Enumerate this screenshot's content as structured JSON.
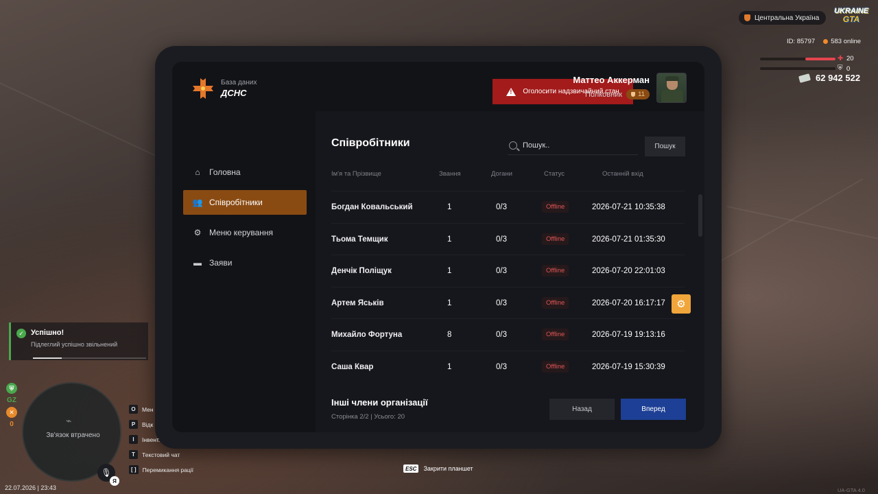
{
  "hud": {
    "region": "Центральна Україна",
    "logo_line1": "UKRAINE",
    "logo_line2": "GTA",
    "player_id": "ID: 85797",
    "online": "583 online",
    "health": "20",
    "armor": "0",
    "health_level": 0.4,
    "money": "62 942 522"
  },
  "tablet": {
    "brand_subtitle": "База даних",
    "brand_title": "ДСНС",
    "alert_button": "Оголосити надзвичайний стан",
    "user_name": "Маттео Аккерман",
    "user_rank": "Полковник",
    "rank_level": "11",
    "nav": [
      {
        "label": "Головна",
        "icon": "home-icon"
      },
      {
        "label": "Співробітники",
        "icon": "users-icon",
        "active": true
      },
      {
        "label": "Меню керування",
        "icon": "gear-icon"
      },
      {
        "label": "Заяви",
        "icon": "folder-icon"
      }
    ],
    "page_title": "Співробітники",
    "search_placeholder": "Пошук..",
    "search_button": "Пошук",
    "columns": [
      "Ім'я та Прізвище",
      "Звання",
      "Догани",
      "Статус",
      "Останній вхід"
    ],
    "employees": [
      {
        "name": "Богдан Ковальський",
        "rank": "1",
        "reprimands": "0/3",
        "status": "Offline",
        "last": "2026-07-21 10:35:38"
      },
      {
        "name": "Тьома Темщик",
        "rank": "1",
        "reprimands": "0/3",
        "status": "Offline",
        "last": "2026-07-21 01:35:30"
      },
      {
        "name": "Денчік Поліщук",
        "rank": "1",
        "reprimands": "0/3",
        "status": "Offline",
        "last": "2026-07-20 22:01:03"
      },
      {
        "name": "Артем Яськів",
        "rank": "1",
        "reprimands": "0/3",
        "status": "Offline",
        "last": "2026-07-20 16:17:17"
      },
      {
        "name": "Михайло Фортуна",
        "rank": "8",
        "reprimands": "0/3",
        "status": "Offline",
        "last": "2026-07-19 19:13:16"
      },
      {
        "name": "Саша Квар",
        "rank": "1",
        "reprimands": "0/3",
        "status": "Offline",
        "last": "2026-07-19 15:30:39"
      }
    ],
    "other_title": "Інші члени організації",
    "page_info": "Сторінка 2/2 | Усього: 20",
    "back_button": "Назад",
    "next_button": "Вперед"
  },
  "toast": {
    "title": "Успішно!",
    "message": "Підлеглий успішно звільнений"
  },
  "left_hud": {
    "gz_label": "GZ",
    "gz_count": "0",
    "minimap_message": "Зв'язок втрачено",
    "mic_key": "Я",
    "datetime": "22.07.2026 | 23:43"
  },
  "keybinds": [
    {
      "key": "O",
      "label": "Мен"
    },
    {
      "key": "P",
      "label": "Відк"
    },
    {
      "key": "I",
      "label": "Інвент."
    },
    {
      "key": "T",
      "label": "Текстовий чат"
    },
    {
      "key": "[ ]",
      "label": "Перемикання рації"
    }
  ],
  "esc_hint": {
    "key": "ESC",
    "label": "Закрити планшет"
  },
  "version": "UA-GTA 4.0"
}
